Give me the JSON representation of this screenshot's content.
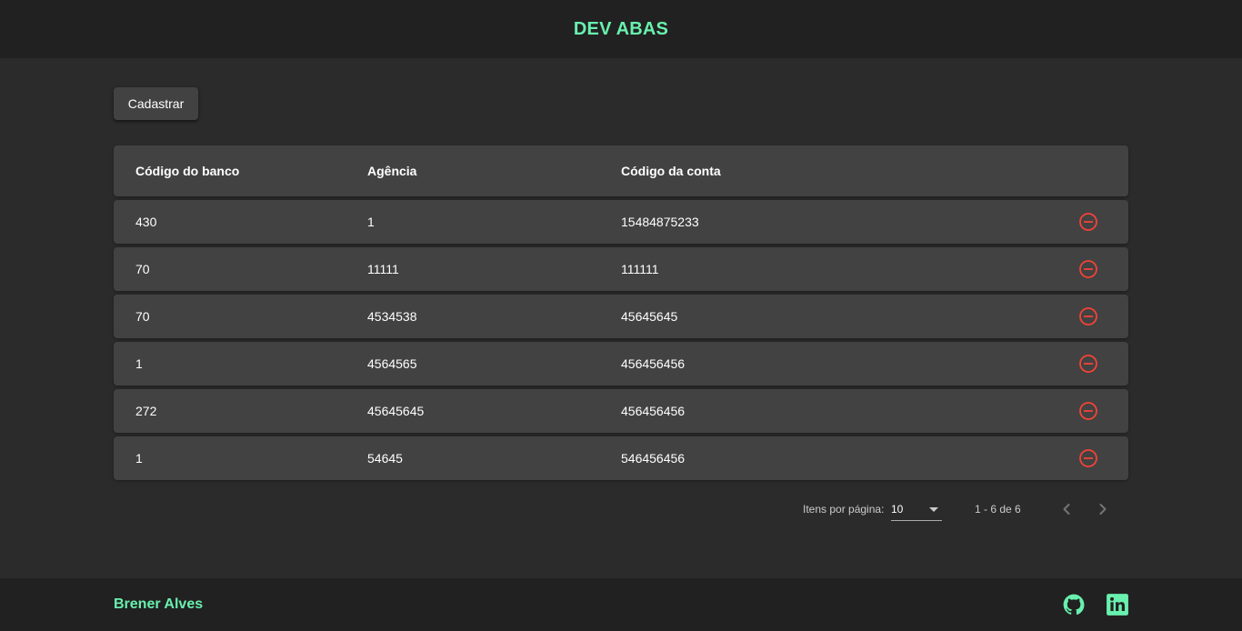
{
  "header": {
    "title": "DEV ABAS"
  },
  "toolbar": {
    "create_label": "Cadastrar"
  },
  "table": {
    "columns": [
      "Código do banco",
      "Agência",
      "Código da conta"
    ],
    "rows": [
      [
        "430",
        "1",
        "15484875233"
      ],
      [
        "70",
        "11111",
        "111111"
      ],
      [
        "70",
        "4534538",
        "45645645"
      ],
      [
        "1",
        "4564565",
        "456456456"
      ],
      [
        "272",
        "45645645",
        "456456456"
      ],
      [
        "1",
        "54645",
        "546456456"
      ]
    ]
  },
  "paginator": {
    "items_label": "Itens por página:",
    "page_size": "10",
    "range_label": "1 - 6 de 6"
  },
  "footer": {
    "name": "Brener Alves",
    "icons": [
      "github-icon",
      "linkedin-icon"
    ]
  },
  "colors": {
    "accent": "#69f0ae",
    "danger": "#f44336",
    "surface": "#424242",
    "background": "#2b2b2b",
    "bar": "#212121"
  }
}
